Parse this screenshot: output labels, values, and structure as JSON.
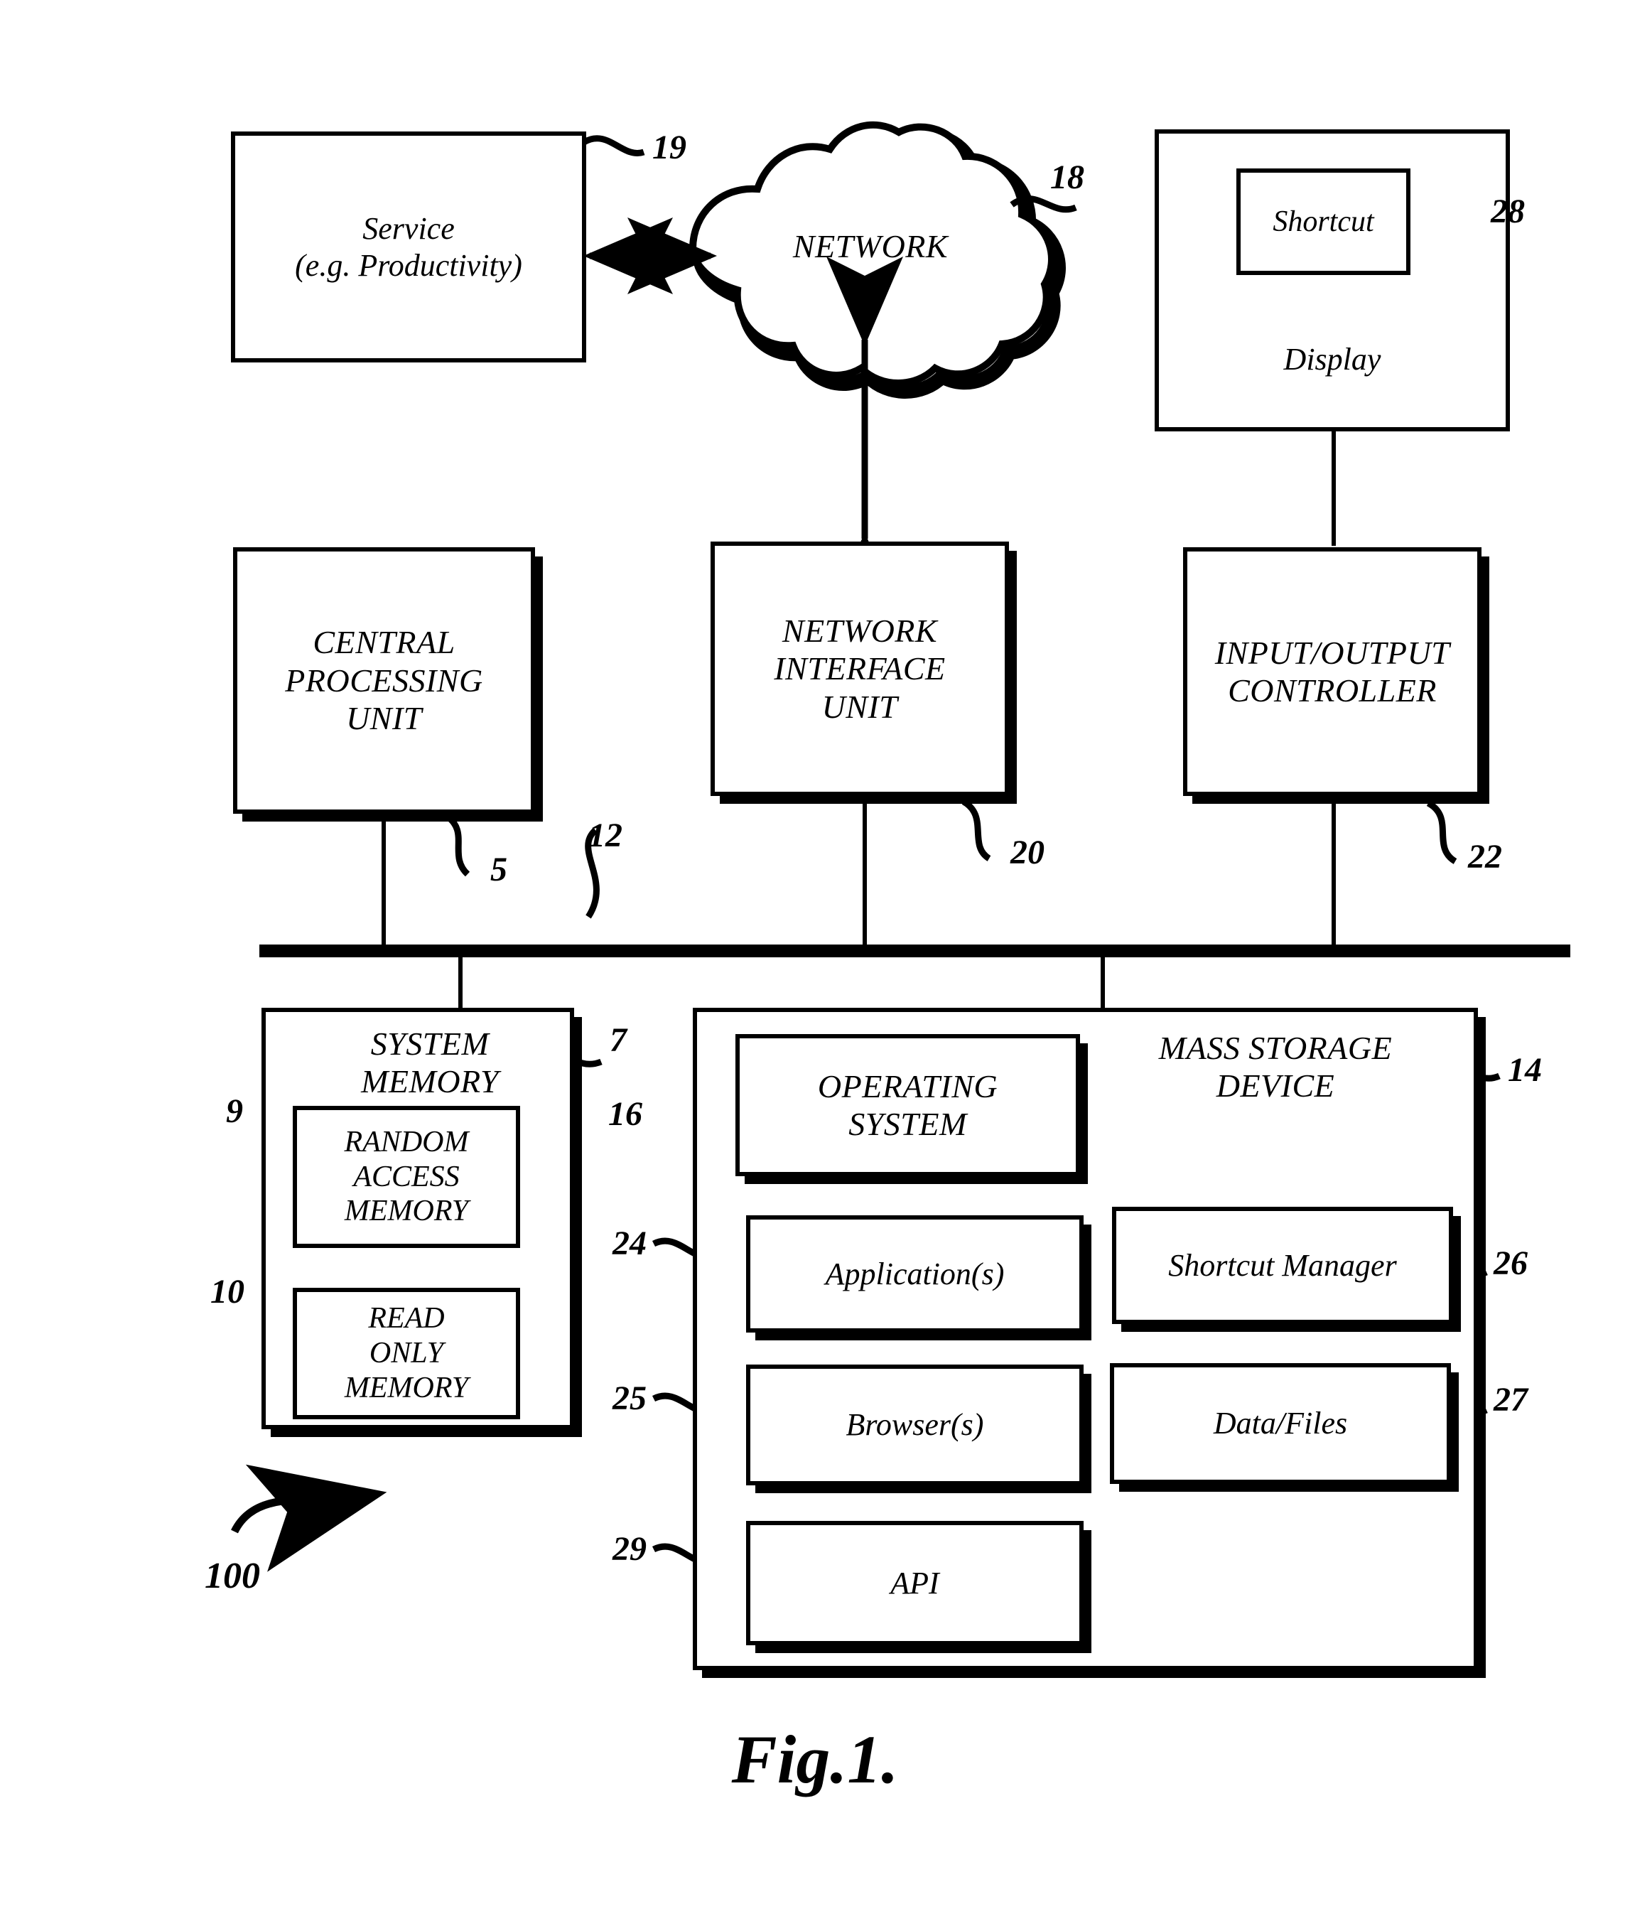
{
  "figure": {
    "caption": "Fig.1.",
    "system_ref": "100"
  },
  "nodes": {
    "service": {
      "line1": "Service",
      "line2": "(e.g. Productivity)",
      "ref": "19"
    },
    "network": {
      "label": "NETWORK",
      "ref": "18"
    },
    "display": {
      "label": "Display",
      "shortcut_label": "Shortcut",
      "ref": "28"
    },
    "cpu": {
      "line1": "CENTRAL",
      "line2": "PROCESSING",
      "line3": "UNIT",
      "ref": "5"
    },
    "network_interface": {
      "line1": "NETWORK",
      "line2": "INTERFACE",
      "line3": "UNIT",
      "ref": "20"
    },
    "io_controller": {
      "line1": "INPUT/OUTPUT",
      "line2": "CONTROLLER",
      "ref": "22"
    },
    "bus": {
      "ref": "12"
    },
    "system_memory": {
      "line1": "SYSTEM",
      "line2": "MEMORY",
      "ref": "7",
      "ram": {
        "line1": "RANDOM",
        "line2": "ACCESS",
        "line3": "MEMORY",
        "ref": "9"
      },
      "rom": {
        "line1": "READ",
        "line2": "ONLY",
        "line3": "MEMORY",
        "ref": "10"
      }
    },
    "mass_storage": {
      "line1": "MASS STORAGE",
      "line2": "DEVICE",
      "ref": "14",
      "items": [
        {
          "key": "operating_system",
          "line1": "OPERATING",
          "line2": "SYSTEM",
          "ref": "16"
        },
        {
          "key": "applications",
          "label": "Application(s)",
          "ref": "24"
        },
        {
          "key": "shortcut_manager",
          "label": "Shortcut Manager",
          "ref": "26"
        },
        {
          "key": "browsers",
          "label": "Browser(s)",
          "ref": "25"
        },
        {
          "key": "data_files",
          "label": "Data/Files",
          "ref": "27"
        },
        {
          "key": "api",
          "label": "API",
          "ref": "29"
        }
      ]
    }
  },
  "colors": {
    "stroke": "#000000",
    "background": "#ffffff"
  }
}
